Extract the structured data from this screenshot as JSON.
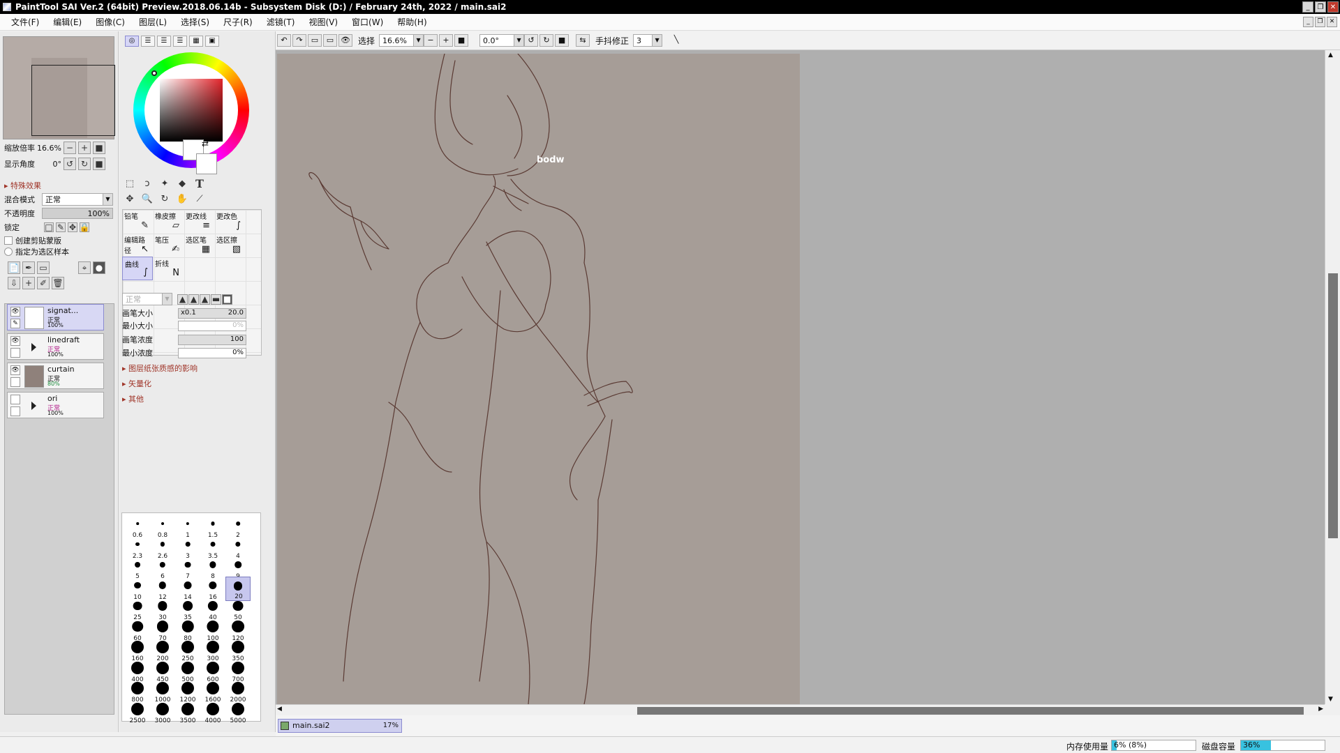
{
  "window": {
    "title": "PaintTool SAI Ver.2 (64bit) Preview.2018.06.14b - Subsystem Disk (D:) / February 24th, 2022 / main.sai2",
    "buttons": [
      "_",
      "❐",
      "✕"
    ]
  },
  "menu": [
    "文件(F)",
    "编辑(E)",
    "图像(C)",
    "图层(L)",
    "选择(S)",
    "尺子(R)",
    "滤镜(T)",
    "视图(V)",
    "窗口(W)",
    "帮助(H)"
  ],
  "navigator": {
    "zoom_label": "缩放倍率",
    "zoom_value": "16.6%",
    "angle_label": "显示角度",
    "angle_value": "0°"
  },
  "layer_props": {
    "effects": "特殊效果",
    "blend_label": "混合模式",
    "blend_value": "正常",
    "opacity_label": "不透明度",
    "opacity_value": "100%",
    "lock_label": "锁定",
    "clip_label": "创建剪贴蒙版",
    "select_source_label": "指定为选区样本"
  },
  "layers": [
    {
      "name": "signat...",
      "mode": "正常",
      "opacity": "100%",
      "selected": true
    },
    {
      "name": "linedraft",
      "mode": "正常",
      "opacity": "100%",
      "folder": true
    },
    {
      "name": "curtain",
      "mode": "正常",
      "opacity": "80%"
    },
    {
      "name": "ori",
      "mode": "正常",
      "opacity": "100%",
      "folder": true
    }
  ],
  "tools": {
    "brushes": [
      {
        "label": "铅笔",
        "icon": "✎"
      },
      {
        "label": "橡皮擦",
        "icon": "▱"
      },
      {
        "label": "更改线",
        "icon": "≡"
      },
      {
        "label": "更改色",
        "icon": "∫"
      },
      {
        "label": "编辑路径",
        "icon": "↖"
      },
      {
        "label": "笔压",
        "icon": "✍"
      },
      {
        "label": "选区笔",
        "icon": "▦"
      },
      {
        "label": "选区擦",
        "icon": "▧"
      },
      {
        "label": "曲线",
        "icon": "∫",
        "active": true
      },
      {
        "label": "折线",
        "icon": "N"
      }
    ],
    "brush_mode": "正常",
    "size_label": "画笔大小",
    "size_mult": "x0.1",
    "size_value": "20.0",
    "min_size_label": "最小大小",
    "min_size_value": "0%",
    "density_label": "画笔浓度",
    "density_value": "100",
    "min_density_label": "最小浓度",
    "min_density_value": "0%",
    "sections": [
      "图层纸张质感的影响",
      "矢量化",
      "其他"
    ]
  },
  "brush_sizes": [
    "0.6",
    "0.8",
    "1",
    "1.5",
    "2",
    "2.3",
    "2.6",
    "3",
    "3.5",
    "4",
    "5",
    "6",
    "7",
    "8",
    "9",
    "10",
    "12",
    "14",
    "16",
    "20",
    "25",
    "30",
    "35",
    "40",
    "50",
    "60",
    "70",
    "80",
    "100",
    "120",
    "160",
    "200",
    "250",
    "300",
    "350",
    "400",
    "450",
    "500",
    "600",
    "700",
    "800",
    "1000",
    "1200",
    "1600",
    "2000",
    "2500",
    "3000",
    "3500",
    "4000",
    "5000"
  ],
  "selected_brush_size": "20",
  "canvas_toolbar": {
    "select_label": "选择",
    "zoom": "16.6%",
    "angle": "0.0°",
    "stabilizer_label": "手抖修正",
    "stabilizer_value": "3"
  },
  "document_tab": {
    "name": "main.sai2",
    "zoom": "17%"
  },
  "status": {
    "mem_label": "内存使用量",
    "mem_value": "6% (8%)",
    "mem_fraction": 0.06,
    "disk_label": "磁盘容量",
    "disk_value": "36%",
    "disk_fraction": 0.36
  },
  "colors": {
    "canvas_paper": "#a69d97",
    "line": "#5a3a33",
    "accent": "#8b8bd0"
  }
}
